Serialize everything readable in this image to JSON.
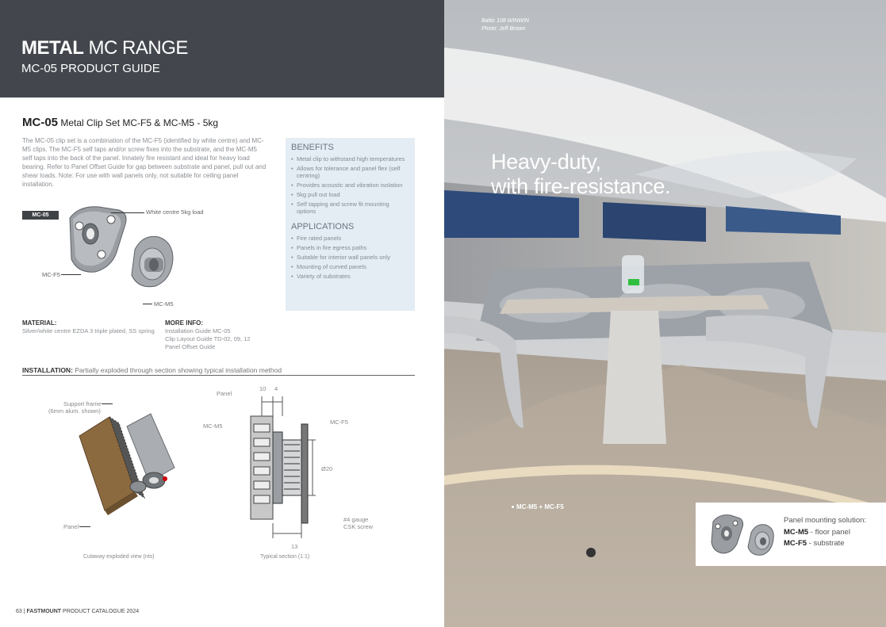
{
  "header": {
    "range_bold": "METAL",
    "range_rest": " MC RANGE",
    "guide": "MC-05 PRODUCT GUIDE"
  },
  "product": {
    "code": "MC-05",
    "name": " Metal Clip Set MC-F5 & MC-M5 - 5kg",
    "intro": "The MC-05 clip set is a combination of the MC-F5 (identified by white centre) and MC-M5 clips. The MC-F5 self taps and/or screw fixes into the substrate, and the MC-M5 self taps into the back of the panel. Innately fire resistant and ideal for heavy load bearing. Refer to Panel Offset Guide for gap between substrate and panel, pull out and shear loads. Note: For use with wall panels only, not suitable for ceiling panel installation."
  },
  "benefits": {
    "heading": "BENEFITS",
    "items": [
      "Metal clip to withstand high temperatures",
      "Allows for tolerance and panel flex (self centring)",
      "Provides acoustic and vibration isolation",
      "5kg pull out load",
      "Self tapping and screw fit mounting options"
    ]
  },
  "applications": {
    "heading": "APPLICATIONS",
    "items": [
      "Fire rated panels",
      "Panels in fire egress paths",
      "Suitable for interior wall panels only",
      "Mounting of curved panels",
      "Variety of substrates"
    ]
  },
  "diagram": {
    "tag": "MC-05",
    "white_centre": "White centre 5kg load",
    "mcf5": "MC-F5",
    "mcm5": "MC-M5"
  },
  "material": {
    "label": "MATERIAL:",
    "value": "Silver/white centre EZDA 3 triple plated, SS spring"
  },
  "more_info": {
    "label": "MORE INFO:",
    "items": [
      "Installation Guide MC-05",
      "Clip Layout Guide TD-02, 09, 12",
      "Panel Offset Guide"
    ]
  },
  "installation": {
    "label": "INSTALLATION:",
    "desc": " Partially exploded through section showing typical installation method",
    "support_frame": "Support frame",
    "support_frame_note": "(6mm alum. shown)",
    "panel": "Panel",
    "cutaway_caption": "Cutaway exploded view (nts)",
    "section_caption": "Typical section (1:1)",
    "sec_panel": "Panel",
    "sec_mcm5": "MC-M5",
    "sec_mcf5": "MC-F5",
    "dim_10": "10",
    "dim_4": "4",
    "dim_20": "Ø20",
    "dim_13": "13",
    "screw_line1": "#4 gauge",
    "screw_line2": "CSK screw"
  },
  "footer": {
    "page": "63",
    "sep": "  |  ",
    "brand": "FASTMOUNT",
    "rest": " PRODUCT CATALOGUE 2024"
  },
  "photo": {
    "credit_line1": "Baltic 108 WINWIN",
    "credit_line2": "Photo: Jeff Brown",
    "tagline_line1": "Heavy-duty,",
    "tagline_line2": "with fire-resistance.",
    "pin_label": "MC-M5 + MC-F5"
  },
  "mount_card": {
    "title": "Panel mounting solution:",
    "line1_bold": "MC-M5",
    "line1_rest": " - floor panel",
    "line2_bold": "MC-F5",
    "line2_rest": " - substrate"
  },
  "colors": {
    "header_bg": "#43474d",
    "benefits_bg": "#e4ecf4"
  }
}
